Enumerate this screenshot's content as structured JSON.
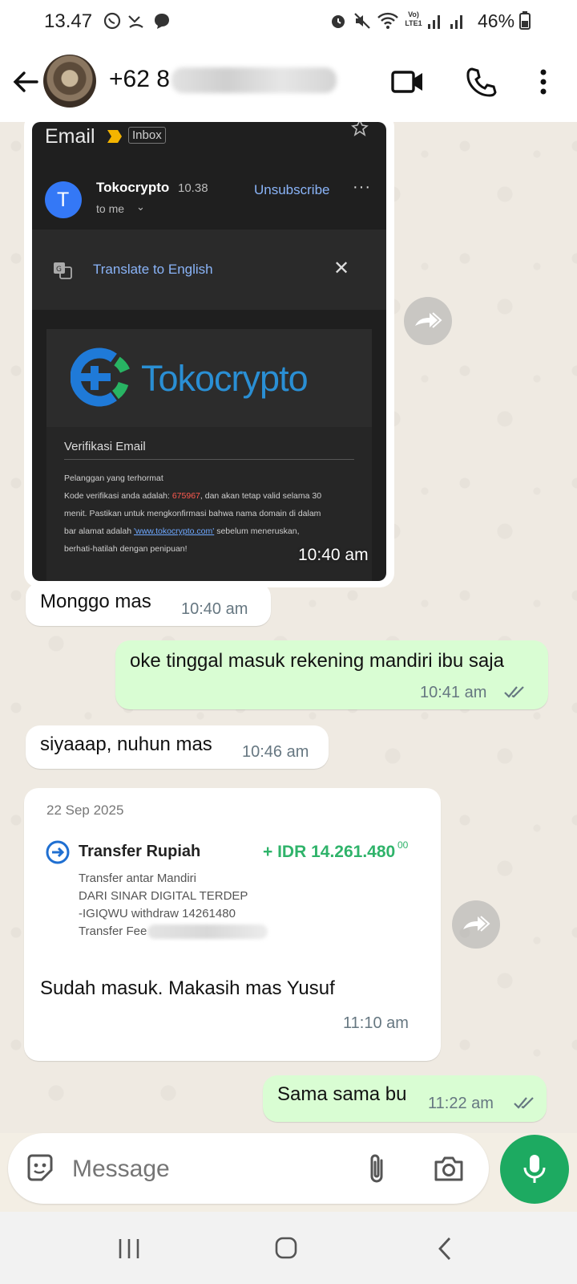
{
  "status_bar": {
    "time": "13.47",
    "battery": "46%",
    "network_label": "Vo) LTE1"
  },
  "header": {
    "contact_name": "+62 8",
    "icons": [
      "back-arrow-icon",
      "avatar",
      "video-call-icon",
      "voice-call-icon",
      "more-vert-icon"
    ]
  },
  "messages": {
    "email_image": {
      "app_title": "Email",
      "inbox_label": "Inbox",
      "sender_initial": "T",
      "sender": "Tokocrypto",
      "sent_time": "10.38",
      "to_me": "to me",
      "unsubscribe": "Unsubscribe",
      "translate": "Translate to English",
      "brand": "Tokocrypto",
      "email_heading": "Verifikasi Email",
      "greeting": "Pelanggan yang terhormat",
      "line1_prefix": "Kode verifikasi anda adalah: ",
      "code": "675967",
      "line1_suffix": ", dan akan tetap valid selama 30",
      "line2": "menit. Pastikan untuk mengkonfirmasi bahwa nama domain di dalam",
      "line3_prefix": "bar alamat adalah ",
      "link": "'www.tokocrypto.com'",
      "line3_suffix": " sebelum meneruskan,",
      "line4": "berhati-hatilah dengan penipuan!",
      "time": "10:40 am"
    },
    "m1": {
      "text": "Monggo mas",
      "time": "10:40 am"
    },
    "m2": {
      "text": "oke tinggal masuk rekening mandiri ibu saja",
      "time": "10:41 am"
    },
    "m3": {
      "text": "siyaaap, nuhun mas",
      "time": "10:46 am"
    },
    "transfer": {
      "date": "22 Sep 2025",
      "title": "Transfer Rupiah",
      "amount": "+ IDR 14.261.480",
      "amount_cents": "00",
      "line1": "Transfer antar Mandiri",
      "line2": "DARI SINAR DIGITAL TERDEP",
      "line3": "-IGIQWU withdraw 14261480",
      "line4": "Transfer Fee",
      "caption": "Sudah masuk. Makasih mas Yusuf",
      "time": "11:10 am"
    },
    "m4": {
      "text": "Sama sama bu",
      "time": "11:22 am"
    }
  },
  "input": {
    "placeholder": "Message"
  },
  "colors": {
    "outgoing_bubble": "#d9fdd3",
    "incoming_bubble": "#ffffff",
    "chat_bg": "#efeae2",
    "accent_green": "#1daa61",
    "read_ticks": "#667781",
    "amount_green": "#2fb36a"
  }
}
